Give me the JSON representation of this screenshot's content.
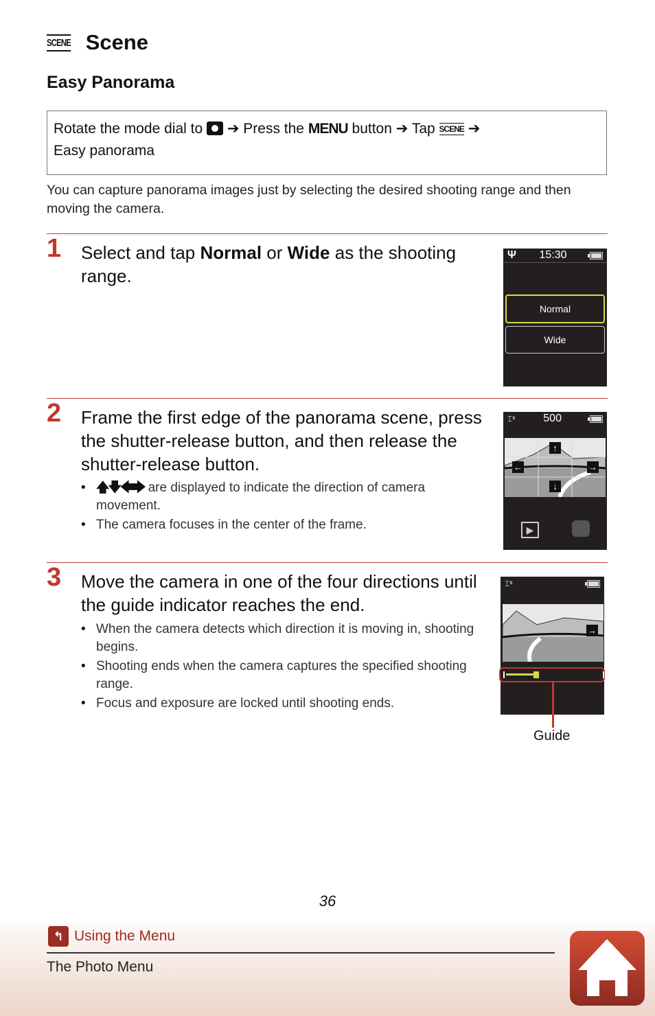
{
  "header": {
    "scene_icon_text": "SCENE",
    "title": "Scene",
    "subtitle": "Easy Panorama"
  },
  "path_box": {
    "part1": "Rotate the mode dial to",
    "arrow": "➔",
    "part2": "Press the",
    "menu_word": "MENU",
    "part3": "button",
    "part4": "Tap",
    "scene_text": "SCENE",
    "part5": "Easy panorama"
  },
  "intro": "You can capture panorama images just by selecting the desired shooting range and then moving the camera.",
  "steps": [
    {
      "number": "1",
      "text_a": "Select and tap ",
      "bold_a": "Normal",
      "text_b": " or ",
      "bold_b": "Wide",
      "text_c": " as the shooting range.",
      "screen": {
        "time": "15:30",
        "options": [
          "Normal",
          "Wide"
        ],
        "selected": "Normal"
      }
    },
    {
      "number": "2",
      "text": "Frame the first edge of the panorama scene, press the shutter-release button, and then release the shutter-release button.",
      "bullets": [
        {
          "dirs": "🡅🡇🡄🡆",
          "text": " are displayed to indicate the direction of camera movement."
        },
        {
          "text": "The camera focuses in the center of the frame."
        }
      ],
      "screen": {
        "count": "500"
      }
    },
    {
      "number": "3",
      "text": "Move the camera in one of the four directions until the guide indicator reaches the end.",
      "bullets": [
        "When the camera detects which direction it is moving in, shooting begins.",
        "Shooting ends when the camera captures the specified shooting range.",
        "Focus and exposure are locked until shooting ends."
      ],
      "screen": {
        "guide_progress": 0.3,
        "guide_label": "Guide"
      }
    }
  ],
  "footer": {
    "page_number": "36",
    "back_link": "Using the Menu",
    "section": "The Photo Menu"
  },
  "colors": {
    "accent": "#c0392b",
    "screen_bg": "#231f20",
    "highlight": "#d6d84a"
  }
}
